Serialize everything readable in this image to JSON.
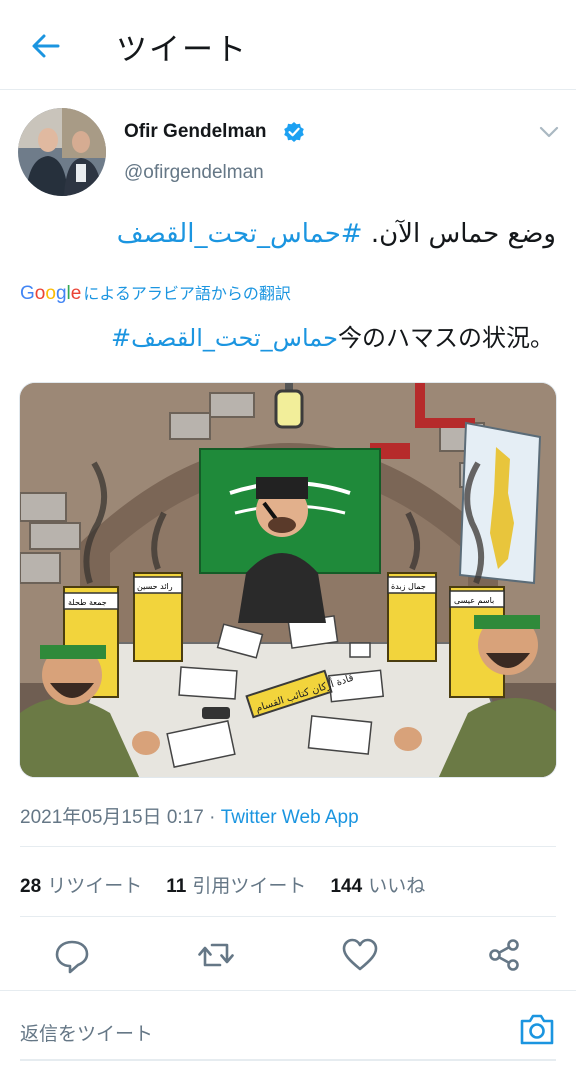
{
  "header": {
    "title": "ツイート",
    "back_icon": "arrow-left-icon"
  },
  "author": {
    "name": "Ofir Gendelman",
    "handle": "@ofirgendelman",
    "verified": true
  },
  "tweet": {
    "text_prefix": "وضع حماس الآن.",
    "hashtag": "#حماس_تحت_القصف",
    "translation_label": "によるアラビア語からの翻訳",
    "google_logo": "Google",
    "translation_hashtag": "#حماس_تحت_القصف",
    "translation_suffix": "今のハマスの状況。"
  },
  "media": {
    "banner_text": "قادة أركان كتائب القسام",
    "name_tags": [
      "جمعة طحلة",
      "رائد حسين",
      "جمال زبدة",
      "باسم عيسى"
    ]
  },
  "meta": {
    "datetime": "2021年05月15日 0:17",
    "separator": " · ",
    "source": "Twitter Web App"
  },
  "stats": {
    "retweets_count": "28",
    "retweets_label": "リツイート",
    "quotes_count": "11",
    "quotes_label": "引用ツイート",
    "likes_count": "144",
    "likes_label": "いいね"
  },
  "actions": [
    "reply-icon",
    "retweet-icon",
    "like-icon",
    "share-icon"
  ],
  "reply": {
    "placeholder": "返信をツイート",
    "camera_icon": "camera-icon"
  },
  "colors": {
    "accent": "#1b95e0",
    "text": "#14171a",
    "muted": "#657786",
    "divider": "#e6ecf0"
  }
}
